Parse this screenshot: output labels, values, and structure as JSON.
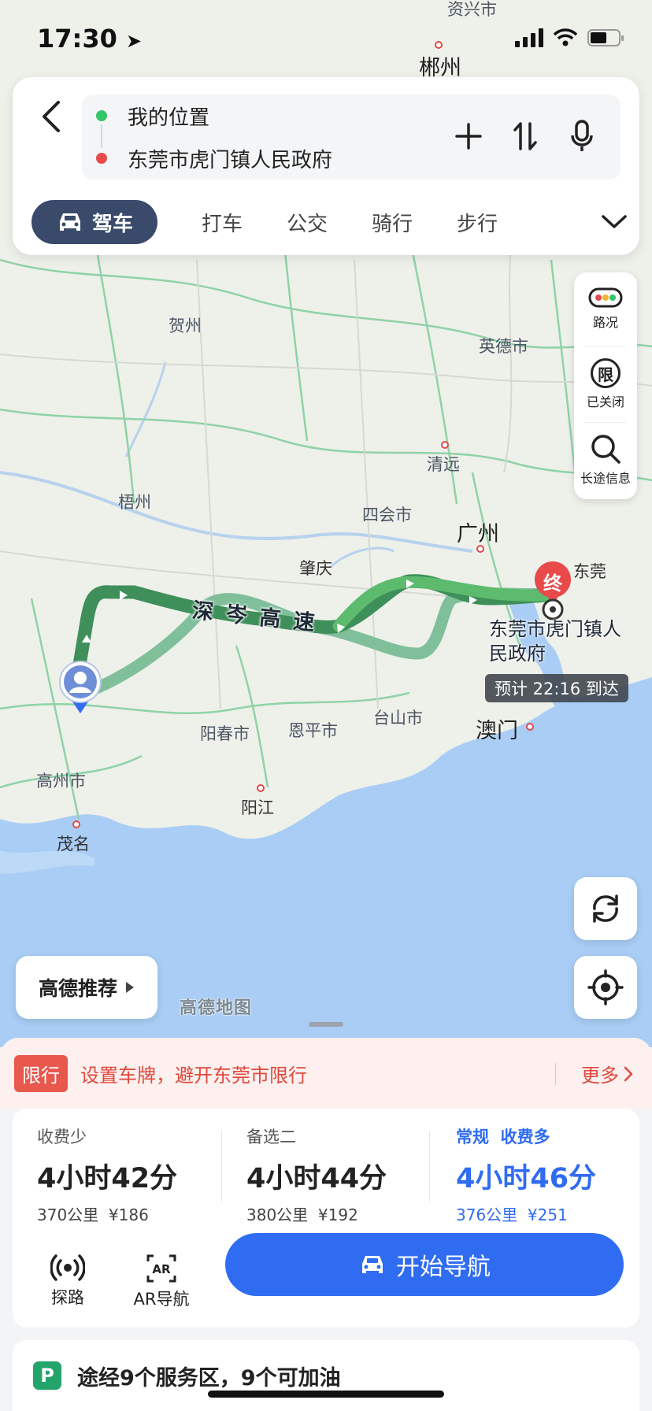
{
  "status_bar": {
    "time": "17:30"
  },
  "search": {
    "origin": "我的位置",
    "destination": "东莞市虎门镇人民政府",
    "origin_color": "#34c46a",
    "destination_color": "#e84a4a"
  },
  "mode_tabs": {
    "active": "驾车",
    "items": [
      "打车",
      "公交",
      "骑行",
      "步行"
    ]
  },
  "map_controls": {
    "traffic": "路况",
    "restriction": "已关闭",
    "restriction_icon_text": "限",
    "long_trip": "长途信息",
    "recommend": "高德推荐",
    "map_brand": "高德地图"
  },
  "map_labels": {
    "cities": [
      "资兴市",
      "郴州",
      "贺州",
      "英德市",
      "清远",
      "梧州",
      "四会市",
      "广州",
      "肇庆",
      "东莞",
      "阳春市",
      "恩平市",
      "台山市",
      "澳门",
      "高州市",
      "阳江",
      "茂名"
    ],
    "road": "深岑高速",
    "destination_marker": "终",
    "destination_name": "东莞市虎门镇人民政府",
    "eta": "预计 22:16 到达"
  },
  "restriction_bar": {
    "badge": "限行",
    "text": "设置车牌，避开东莞市限行",
    "more": "更多"
  },
  "routes": [
    {
      "tag": "收费少",
      "duration": "4小时42分",
      "distance": "370公里",
      "toll": "¥186",
      "selected": false
    },
    {
      "tag": "备选二",
      "duration": "4小时44分",
      "distance": "380公里",
      "toll": "¥192",
      "selected": false
    },
    {
      "tag": "常规  收费多",
      "duration": "4小时46分",
      "distance": "376公里",
      "toll": "¥251",
      "selected": true
    }
  ],
  "actions": {
    "explore": "探路",
    "ar_nav": "AR导航",
    "start_nav": "开始导航"
  },
  "service_info": {
    "icon_text": "P",
    "text": "途经9个服务区，9个可加油"
  },
  "colors": {
    "accent_blue": "#2f6cf1",
    "route_primary": "#3f8f5a",
    "route_alt": "#7fbf9a",
    "restriction_red": "#e0483c",
    "tab_active_bg": "#3a4a6b"
  }
}
